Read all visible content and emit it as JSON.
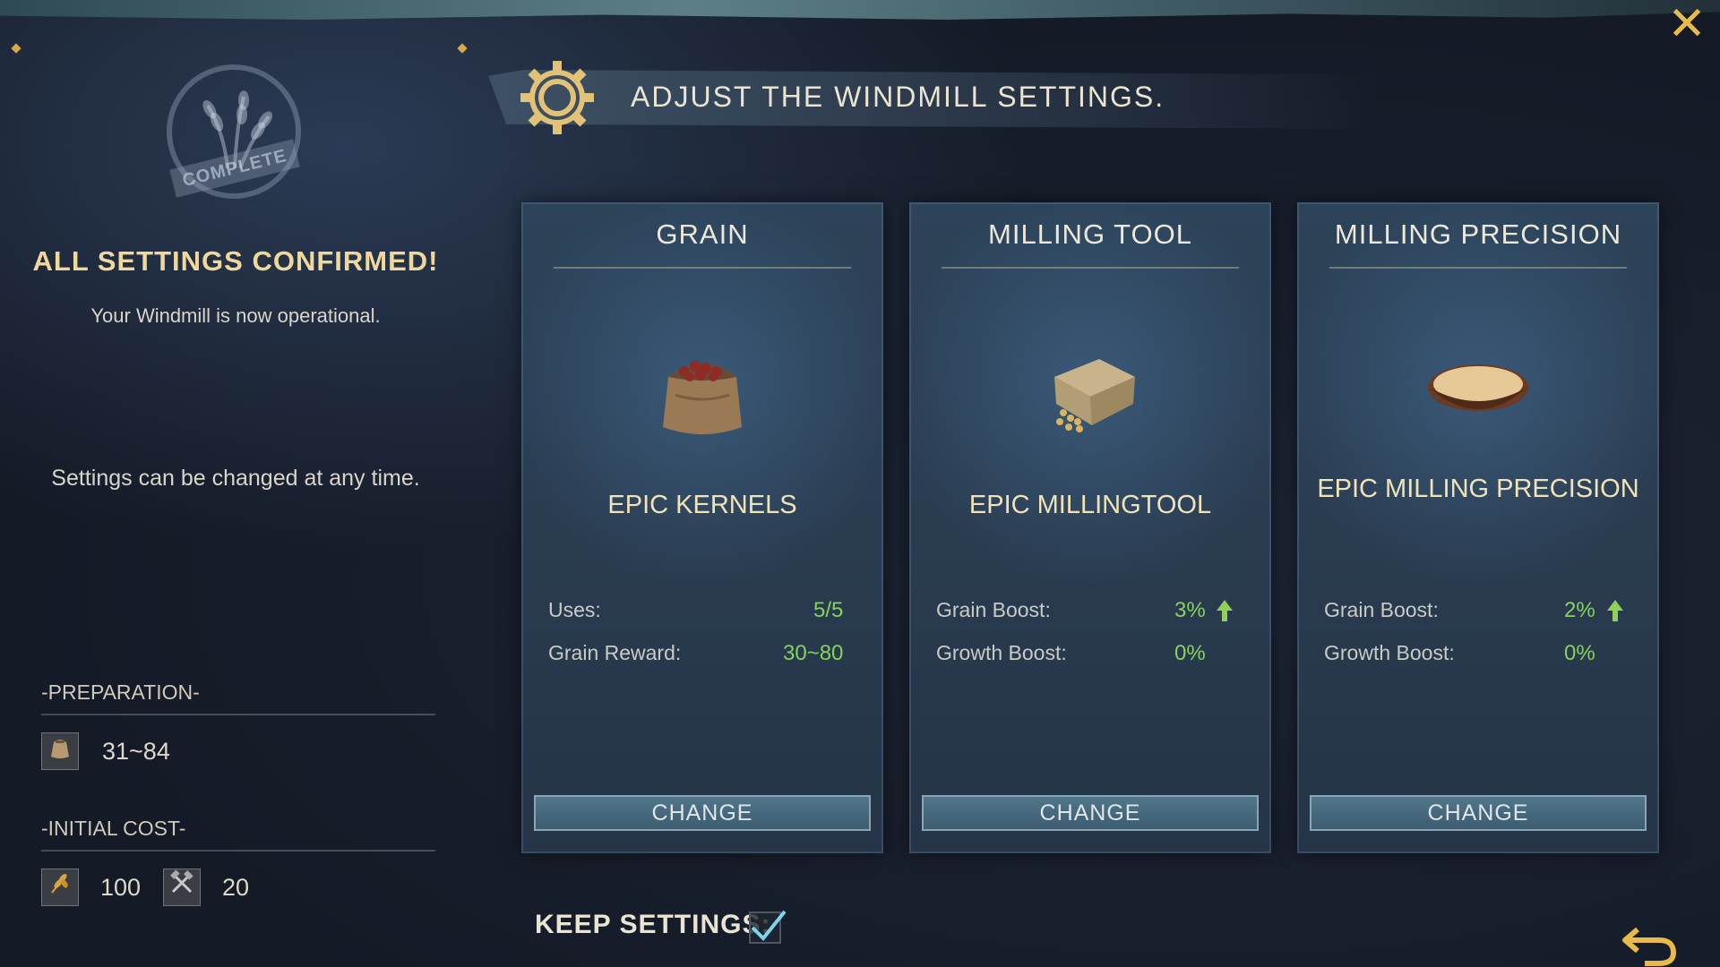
{
  "header": {
    "title": "ADJUST THE WINDMILL SETTINGS."
  },
  "status": {
    "stamp": "COMPLETE",
    "title": "ALL SETTINGS CONFIRMED!",
    "subtitle": "Your Windmill is now operational.",
    "note": "Settings can be changed at any time."
  },
  "preparation": {
    "heading": "-PREPARATION-",
    "value": "31~84"
  },
  "initial_cost": {
    "heading": "-INITIAL COST-",
    "wheat": "100",
    "tools": "20"
  },
  "cards": [
    {
      "title": "GRAIN",
      "item": "EPIC KERNELS",
      "stats": [
        {
          "label": "Uses:",
          "value": "5/5"
        },
        {
          "label": "Grain Reward:",
          "value": "30~80"
        }
      ],
      "button": "CHANGE"
    },
    {
      "title": "MILLING TOOL",
      "item": "EPIC MILLINGTOOL",
      "stats": [
        {
          "label": "Grain Boost:",
          "value": "3%"
        },
        {
          "label": "Growth Boost:",
          "value": "0%"
        }
      ],
      "button": "CHANGE"
    },
    {
      "title": "MILLING PRECISION",
      "item": "EPIC MILLING PRECISION",
      "stats": [
        {
          "label": "Grain Boost:",
          "value": "2%"
        },
        {
          "label": "Growth Boost:",
          "value": "0%"
        }
      ],
      "button": "CHANGE"
    }
  ],
  "keep_settings": {
    "label": "KEEP SETTINGS:",
    "checked": true
  },
  "colors": {
    "accent_gold": "#e9b94a",
    "boost_green": "#86d35b",
    "title_cream": "#f0d79b"
  }
}
